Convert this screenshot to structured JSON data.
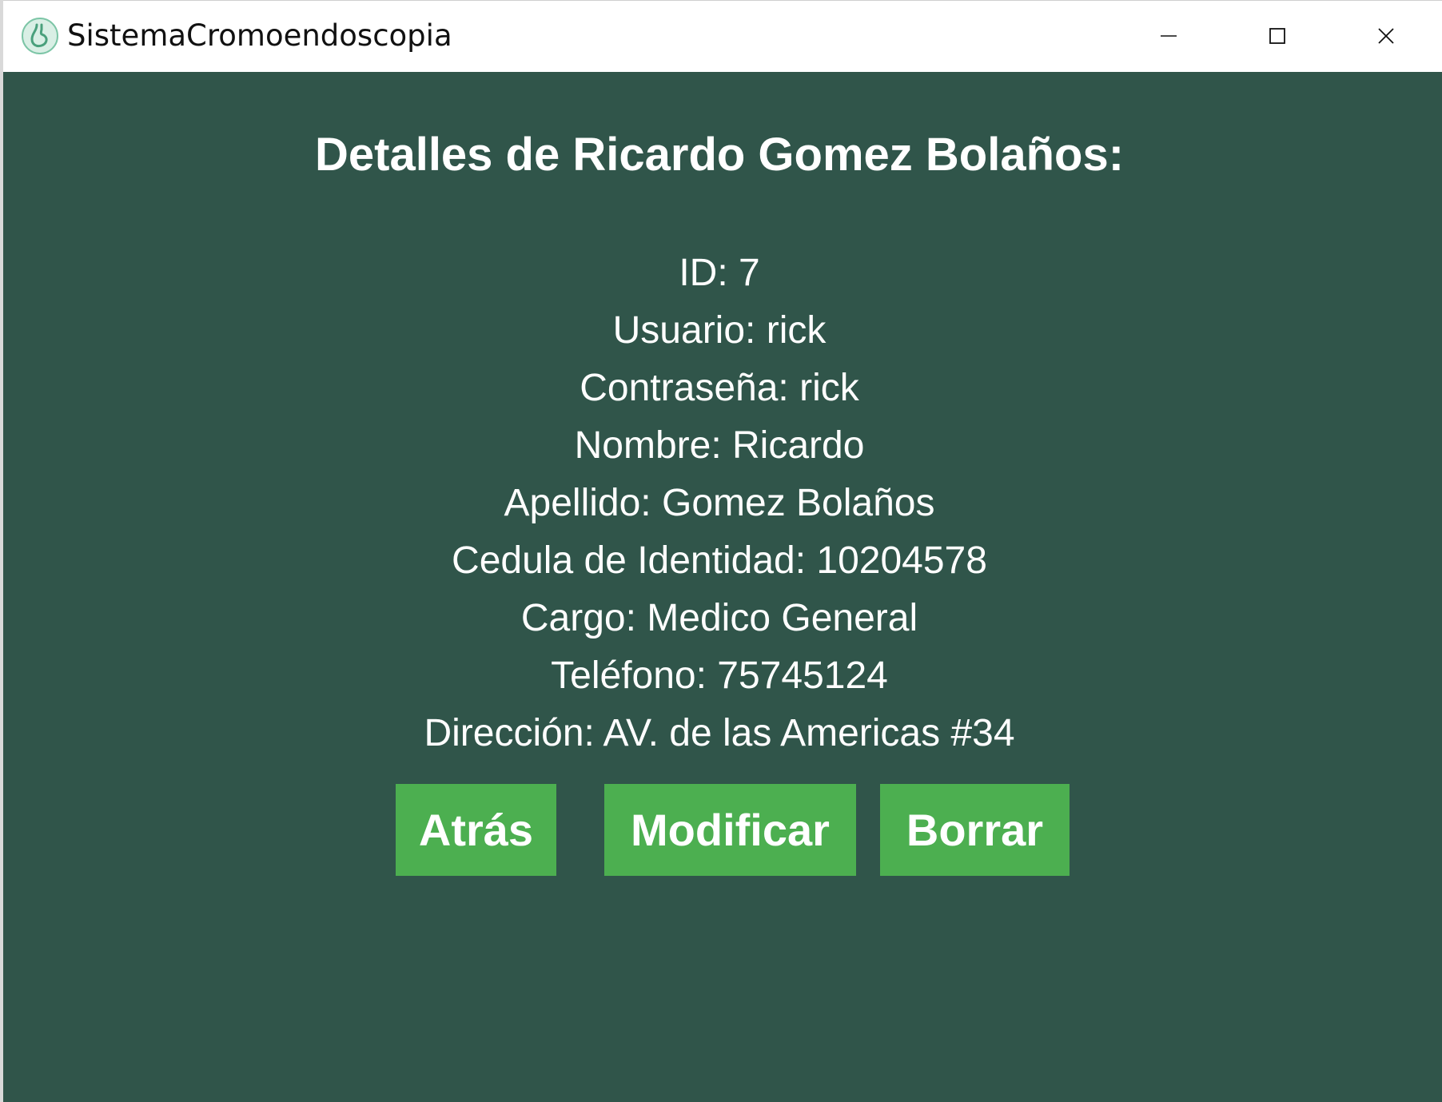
{
  "window": {
    "title": "SistemaCromoendoscopia",
    "icon": "stomach-app-icon",
    "controls": [
      "minimize-icon",
      "maximize-icon",
      "close-icon"
    ]
  },
  "colors": {
    "background": "#30554a",
    "button": "#4caf50",
    "text": "#ffffff"
  },
  "main": {
    "heading": "Detalles de Ricardo Gomez Bolaños:",
    "details": [
      "ID: 7",
      "Usuario: rick",
      "Contraseña: rick",
      "Nombre: Ricardo",
      "Apellido: Gomez Bolaños",
      "Cedula de Identidad: 10204578",
      "Cargo: Medico General",
      "Teléfono: 75745124",
      "Dirección: AV. de las Americas #34"
    ],
    "buttons": {
      "back": "Atrás",
      "modify": "Modificar",
      "delete": "Borrar"
    }
  }
}
